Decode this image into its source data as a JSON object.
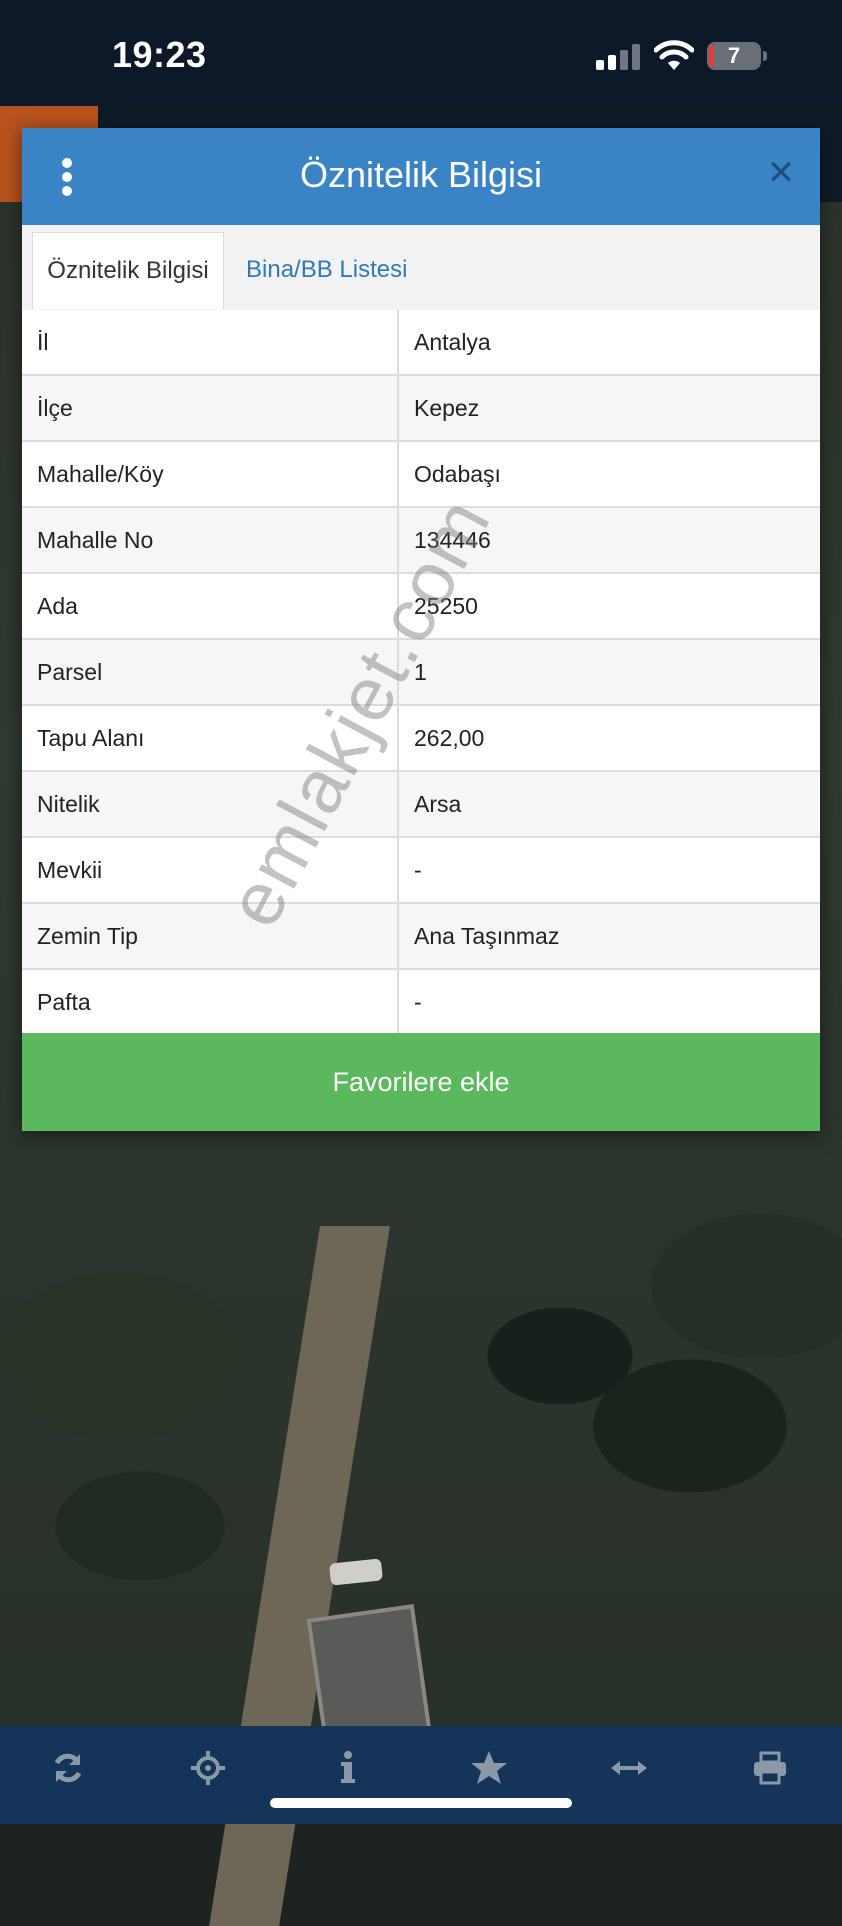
{
  "status_bar": {
    "time": "19:23",
    "battery": "7",
    "icons": [
      "signal-icon",
      "wifi-icon",
      "battery-icon"
    ]
  },
  "modal": {
    "title": "Öznitelik Bilgisi",
    "menu_icon": "more-vertical-icon",
    "close_icon": "close-icon",
    "tabs": [
      {
        "label": "Öznitelik Bilgisi",
        "active": true
      },
      {
        "label": "Bina/BB Listesi",
        "active": false
      }
    ],
    "rows": [
      {
        "key": "İl",
        "value": "Antalya"
      },
      {
        "key": "İlçe",
        "value": "Kepez"
      },
      {
        "key": "Mahalle/Köy",
        "value": "Odabaşı"
      },
      {
        "key": "Mahalle No",
        "value": "134446"
      },
      {
        "key": "Ada",
        "value": "25250"
      },
      {
        "key": "Parsel",
        "value": "1"
      },
      {
        "key": "Tapu Alanı",
        "value": "262,00"
      },
      {
        "key": "Nitelik",
        "value": "Arsa"
      },
      {
        "key": "Mevkii",
        "value": "-"
      },
      {
        "key": "Zemin Tip",
        "value": "Ana Taşınmaz"
      },
      {
        "key": "Pafta",
        "value": "-"
      }
    ],
    "favorite_button": "Favorilere ekle"
  },
  "watermark": "emlakjet.com",
  "toolbar": {
    "icons": [
      "refresh-icon",
      "locate-icon",
      "info-icon",
      "star-icon",
      "measure-icon",
      "print-icon"
    ]
  },
  "colors": {
    "header_blue": "#3a84c6",
    "button_green": "#5cb85c",
    "toolbar_navy": "#14345a",
    "link_blue": "#2f7ab8"
  }
}
